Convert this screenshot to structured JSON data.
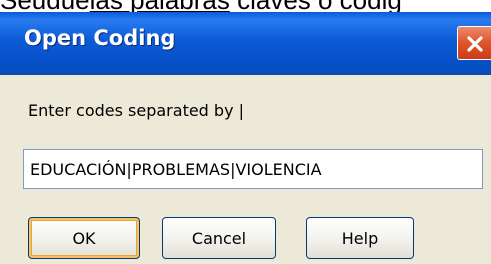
{
  "background": {
    "text_partial": "Seudue",
    "text_underlined": "las palabras",
    "text_rest": " claves o codig"
  },
  "dialog": {
    "title": "Open Coding",
    "close_icon": "close-icon",
    "prompt_label": "Enter codes separated by |",
    "codes_value": "EDUCACIÓN|PROBLEMAS|VIOLENCIA",
    "buttons": {
      "ok": "OK",
      "cancel": "Cancel",
      "help": "Help"
    }
  },
  "colors": {
    "titlebar": "#0b5bd6",
    "close_button": "#e0582e",
    "dialog_bg": "#ece9d8",
    "input_border": "#7f9db9",
    "button_border": "#003c74",
    "default_button_glow": "#f6c066"
  }
}
